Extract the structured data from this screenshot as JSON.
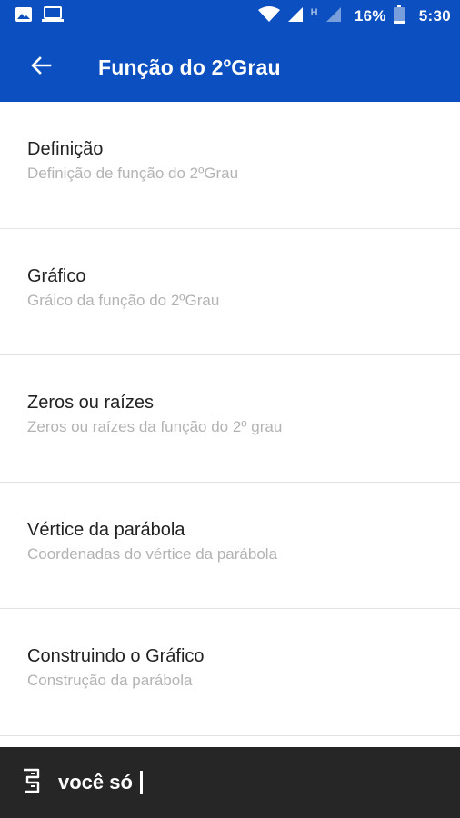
{
  "status_bar": {
    "icons_left": [
      "image-icon",
      "laptop-icon"
    ],
    "network_type": "H",
    "battery_percent": "16%",
    "time": "5:30"
  },
  "app_bar": {
    "title": "Função do 2ºGrau"
  },
  "list_items": [
    {
      "title": "Definição",
      "subtitle": "Definição de função do 2ºGrau"
    },
    {
      "title": "Gráfico",
      "subtitle": "Gráico da função do 2ºGrau"
    },
    {
      "title": "Zeros ou raízes",
      "subtitle": "Zeros ou raízes da função do 2º grau"
    },
    {
      "title": "Vértice da parábola",
      "subtitle": "Coordenadas do vértice da parábola"
    },
    {
      "title": "Construindo o Gráfico",
      "subtitle": "Construção da parábola"
    }
  ],
  "banner": {
    "text": "você só"
  },
  "colors": {
    "primary": "#0b4fc0",
    "banner_bg": "#262626",
    "subtitle": "#b3b3b3"
  }
}
